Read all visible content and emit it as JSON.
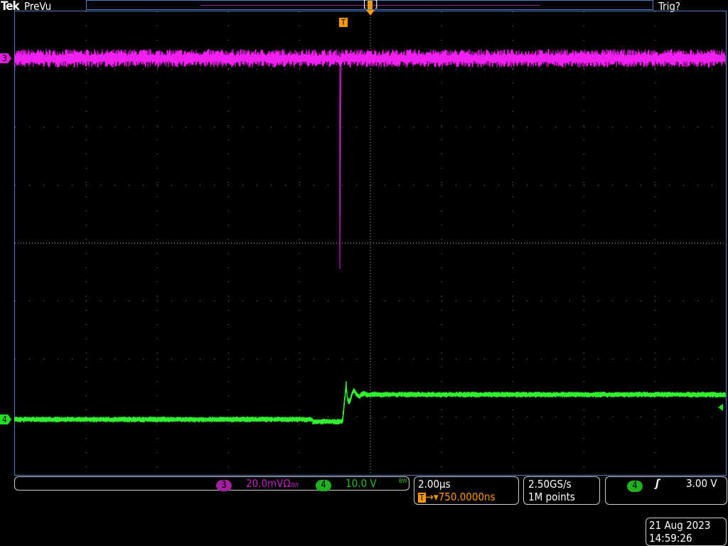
{
  "header": {
    "brand": "Tek",
    "mode": "PreVu",
    "trigger_state": "Trig?"
  },
  "channels": [
    {
      "number": "3",
      "scale": "20.0mV",
      "suffix": "Ω",
      "bw": "BW",
      "color": "#e020e0"
    },
    {
      "number": "4",
      "scale": "10.0 V",
      "bw": "BW",
      "color": "#22e022"
    }
  ],
  "timebase": {
    "scale": "2.00µs",
    "trigger_position": "750.0000ns",
    "trigger_icon": "T"
  },
  "acquisition": {
    "sample_rate": "2.50GS/s",
    "record_length": "1M points"
  },
  "trigger": {
    "source": "4",
    "slope": "rising-edge-icon",
    "level": "3.00 V"
  },
  "datetime": {
    "date": "21 Aug 2023",
    "time": "14:59:26"
  },
  "colors": {
    "trigger": "#ff9900",
    "grid": "#4a7fc0"
  }
}
